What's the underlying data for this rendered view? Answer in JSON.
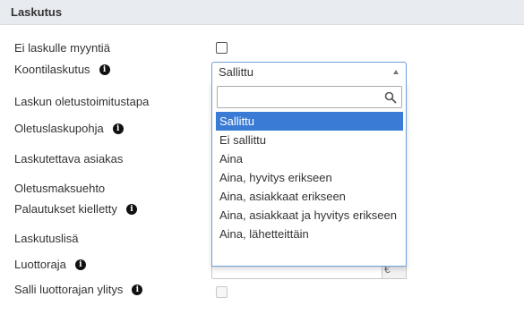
{
  "section": {
    "title": "Laskutus"
  },
  "rows": [
    {
      "label": "Ei laskulle myyntiä",
      "has_info": false
    },
    {
      "label": "Koontilaskutus",
      "has_info": true
    },
    {
      "label": "Laskun oletustoimitustapa",
      "has_info": false
    },
    {
      "label": "Oletuslaskupohja",
      "has_info": true
    },
    {
      "label": "Laskutettava asiakas",
      "has_info": false
    },
    {
      "label": "Oletusmaksuehto",
      "has_info": false
    },
    {
      "label": "Palautukset kielletty",
      "has_info": true
    },
    {
      "label": "Laskutuslisä",
      "has_info": false
    },
    {
      "label": "Luottoraja",
      "has_info": true
    },
    {
      "label": "Salli luottorajan ylitys",
      "has_info": true
    }
  ],
  "info_glyph": "i",
  "koontilaskutus_select": {
    "selected_value": "Sallittu",
    "search_value": "",
    "options": [
      "Sallittu",
      "Ei sallittu",
      "Aina",
      "Aina, hyvitys erikseen",
      "Aina, asiakkaat erikseen",
      "Aina, asiakkaat ja hyvitys erikseen",
      "Aina, lähetteittäin"
    ],
    "selected_index": 0
  },
  "luottoraja_addon": "€",
  "colors": {
    "accent": "#3a7bd5",
    "header_bg": "#e8ecf0",
    "focus_border": "#6f9fd8"
  }
}
